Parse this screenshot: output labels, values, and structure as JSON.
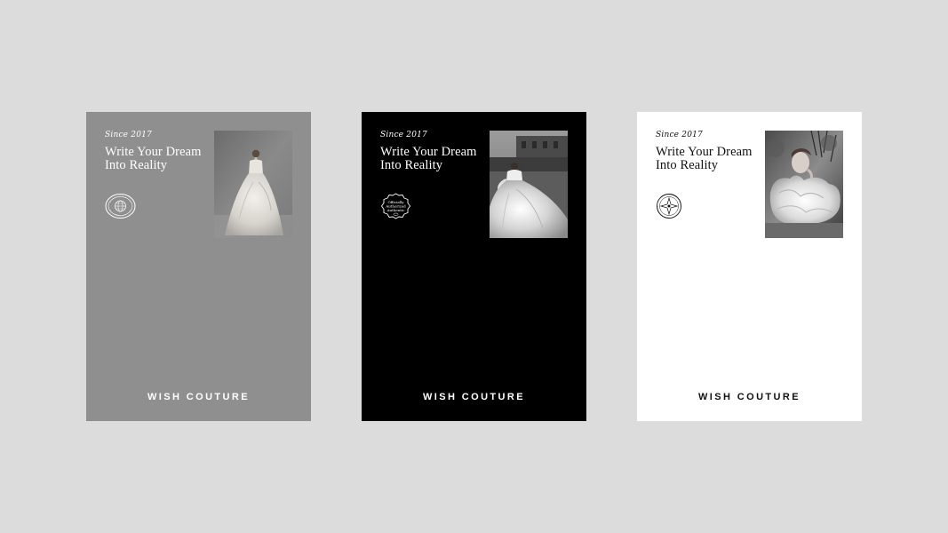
{
  "cards": [
    {
      "variant": "gray",
      "since": "Since 2017",
      "headline_line1": "Write Your Dream",
      "headline_line2": "Into Reality",
      "seal": "globe-seal-icon",
      "photo": "bride-ballgown-studio",
      "brand": "WISH COUTURE"
    },
    {
      "variant": "black",
      "since": "Since 2017",
      "headline_line1": "Write Your Dream",
      "headline_line2": "Into Reality",
      "seal": "officially-authorized-seal-icon",
      "seal_text_line1": "Officially",
      "seal_text_line2": "Authorized",
      "seal_text_line3": "Authentic",
      "photo": "bride-ballgown-outdoor",
      "brand": "WISH COUTURE"
    },
    {
      "variant": "white",
      "since": "Since 2017",
      "headline_line1": "Write Your Dream",
      "headline_line2": "Into Reality",
      "seal": "compass-seal-icon",
      "photo": "bride-ruffle-sleeves",
      "brand": "WISH COUTURE"
    }
  ],
  "colors": {
    "background": "#dcdcdc",
    "gray_card": "#8f8f8f",
    "black_card": "#000000",
    "white_card": "#ffffff"
  }
}
